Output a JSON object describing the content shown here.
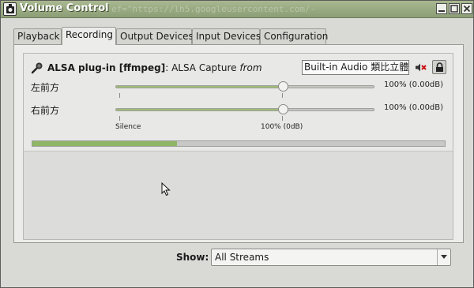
{
  "window": {
    "title": "Volume Control",
    "ghost_text": "ef=\"https://lh5.googleusercontent.com/-",
    "controls": [
      "minimize-icon",
      "maximize-icon",
      "close-icon"
    ]
  },
  "tabs": [
    {
      "label": "Playback",
      "active": false
    },
    {
      "label": "Recording",
      "active": true
    },
    {
      "label": "Output Devices",
      "active": false
    },
    {
      "label": "Input Devices",
      "active": false
    },
    {
      "label": "Configuration",
      "active": false
    }
  ],
  "stream": {
    "icon": "microphone-icon",
    "app_name": "ALSA plug-in [ffmpeg]",
    "separator": ": ",
    "stream_name": "ALSA Capture",
    "from_word": "from",
    "device": "Built-in Audio 類比立體聲",
    "mute_icon": "speaker-muted-icon",
    "lock_icon": "lock-icon",
    "channels": [
      {
        "label": "左前方",
        "volume_percent": 100,
        "volume_text": "100% (0.00dB)"
      },
      {
        "label": "右前方",
        "volume_percent": 100,
        "volume_text": "100% (0.00dB)"
      }
    ],
    "scale": {
      "silence_label": "Silence",
      "norm_label": "100% (0dB)"
    },
    "peak_level_fraction": 0.35
  },
  "footer": {
    "show_label": "Show:",
    "show_value": "All Streams"
  },
  "colors": {
    "titlebar": "#9aaa82",
    "slider_fill": "#9fbd78",
    "peak_fill": "#8fb664",
    "mute_red": "#cc1111"
  }
}
